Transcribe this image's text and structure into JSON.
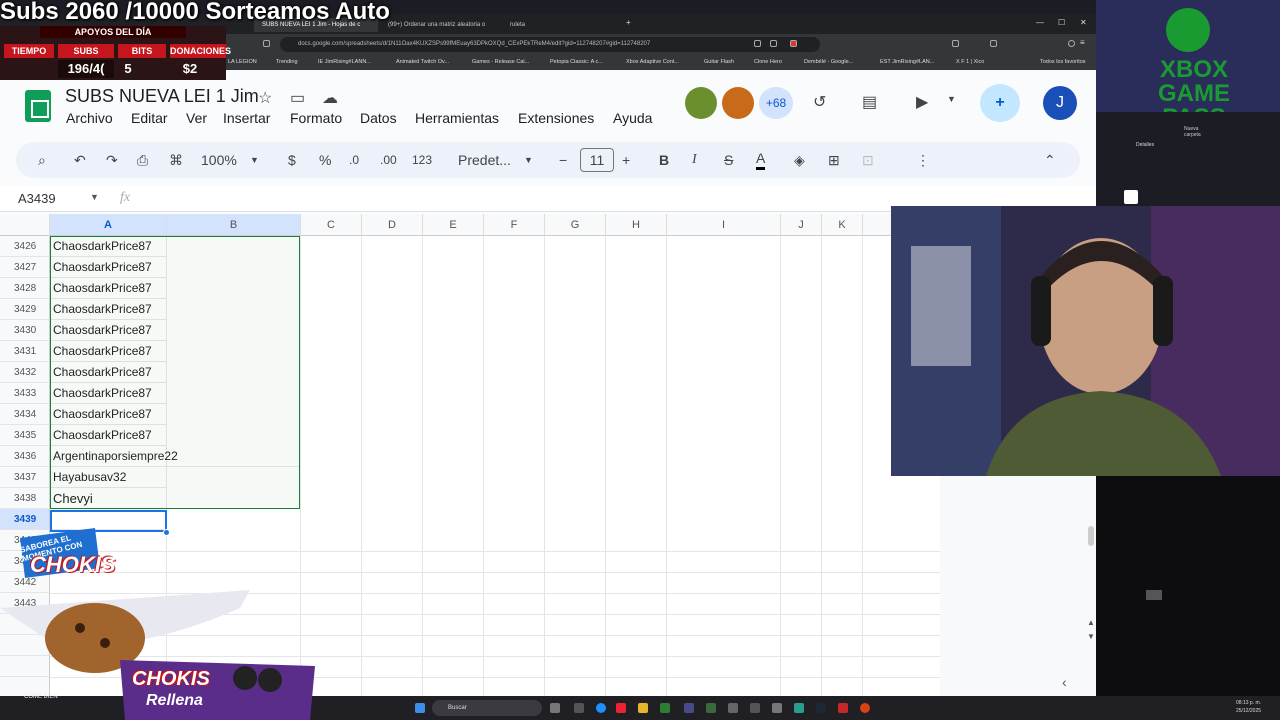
{
  "browser": {
    "tabs": [
      "SUBS NUEVA LEI 1 Jim - Hojas de c",
      "(99+) Ordenar una matriz aleatoria o",
      "ruleta"
    ],
    "url": "docs.google.com/spreadsheets/d/1N11Oax4KUXZSPs99fMEuay63DPkOXQd_CExPEkTReM4/edit?gid=112748207#gid=112748207",
    "bookmarks": [
      "LA LEGION",
      "Trending",
      "IE JimRising#LANN...",
      "Animated Twitch Ov...",
      "Games - Release Cal...",
      "Petopia Classic: A c...",
      "Xbox Adaptive Cont...",
      "Guitar Flash",
      "Clone Hero",
      "Dembélé - Google...",
      "EST JimRising#LAN...",
      "X F 1 | Xico",
      "Todos los favoritos"
    ]
  },
  "sheets": {
    "title": "SUBS NUEVA LEI 1 Jim",
    "menu": [
      "Archivo",
      "Editar",
      "Ver",
      "Insertar",
      "Formato",
      "Datos",
      "Herramientas",
      "Extensiones",
      "Ayuda"
    ],
    "collaborators_more": "+68",
    "account_initial": "J",
    "toolbar": {
      "zoom": "100%",
      "currency": "$",
      "percent": "%",
      "dec_decrease": ".0",
      "dec_increase": ".00",
      "number_format": "123",
      "font": "Predet...",
      "font_size": "11",
      "bold": "B",
      "italic": "I",
      "strike": "S",
      "text_color": "A"
    },
    "name_box": "A3439",
    "fx": "fx",
    "columns": [
      "A",
      "B",
      "C",
      "D",
      "E",
      "F",
      "G",
      "H",
      "I",
      "J",
      "K"
    ],
    "rows": [
      {
        "num": "3426",
        "a": "ChaosdarkPrice87"
      },
      {
        "num": "3427",
        "a": "ChaosdarkPrice87"
      },
      {
        "num": "3428",
        "a": "ChaosdarkPrice87"
      },
      {
        "num": "3429",
        "a": "ChaosdarkPrice87"
      },
      {
        "num": "3430",
        "a": "ChaosdarkPrice87"
      },
      {
        "num": "3431",
        "a": "ChaosdarkPrice87"
      },
      {
        "num": "3432",
        "a": "ChaosdarkPrice87"
      },
      {
        "num": "3433",
        "a": "ChaosdarkPrice87"
      },
      {
        "num": "3434",
        "a": "ChaosdarkPrice87"
      },
      {
        "num": "3435",
        "a": "ChaosdarkPrice87"
      },
      {
        "num": "3436",
        "a": "Argentinaporsiempre22"
      },
      {
        "num": "3437",
        "a": "Hayabusav32"
      },
      {
        "num": "3438",
        "a": "Chevyi"
      },
      {
        "num": "3439",
        "a": ""
      },
      {
        "num": "3440",
        "a": ""
      },
      {
        "num": "3441",
        "a": ""
      },
      {
        "num": "3442",
        "a": ""
      },
      {
        "num": "3443",
        "a": ""
      }
    ]
  },
  "overlay": {
    "stream_title": "Subs 2060 /10000 Sorteamos Auto",
    "apoyos_header": "APOYOS DEL DÍA",
    "labels": [
      "TIEMPO",
      "SUBS",
      "BITS",
      "DONACIONES"
    ],
    "subs_value": "196/4(",
    "bits_value": "5",
    "donaciones_value": "$2",
    "xbox_text": "XBOX GAME PASS",
    "desktop_folder": "Nueva carpeta",
    "desktop_detalles": "Detalles",
    "chokis_badge": "SABOREA EL MOMENTO CON",
    "chokis_brand": "CHOKIS",
    "chokis_relleno": "Rellena",
    "chokis_footer": "COME BIEN"
  },
  "taskbar": {
    "search": "Buscar",
    "time": "08:13 p. m.",
    "date": "25/12/2025"
  }
}
